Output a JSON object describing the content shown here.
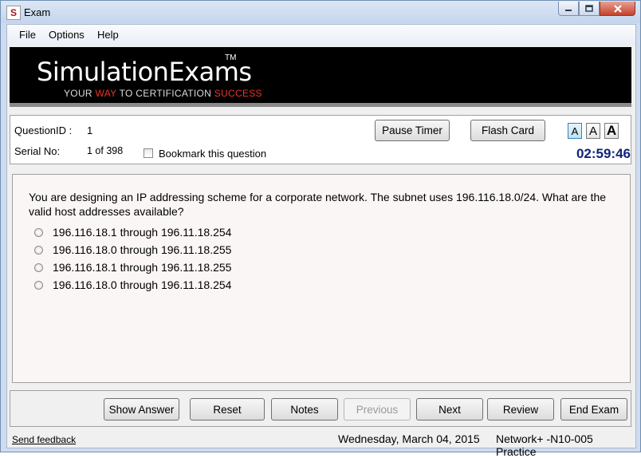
{
  "window": {
    "title": "Exam",
    "app_icon_letter": "S"
  },
  "menu": {
    "file": "File",
    "options": "Options",
    "help": "Help"
  },
  "banner": {
    "brand": "SimulationExams",
    "tm": "TM",
    "tagline_1": "YOUR ",
    "tagline_2": "WAY",
    "tagline_3": " TO CERTIFICATION ",
    "tagline_4": "SUCCESS"
  },
  "question_info": {
    "question_id_label": "QuestionID :",
    "question_id_value": "1",
    "serial_label": "Serial No:",
    "serial_value": "1 of 398",
    "bookmark_label": "Bookmark this question",
    "pause_timer": "Pause Timer",
    "flash_card": "Flash Card",
    "font_small": "A",
    "font_medium": "A",
    "font_large": "A",
    "timer": "02:59:46"
  },
  "question": {
    "text": "You are designing an IP addressing scheme for a corporate network. The subnet uses 196.116.18.0/24. What are the valid host addresses available?",
    "options": [
      "196.116.18.1 through 196.11.18.254",
      "196.116.18.0 through 196.11.18.255",
      "196.116.18.1 through 196.11.18.255",
      "196.116.18.0 through 196.11.18.254"
    ]
  },
  "nav": {
    "show_answer": "Show Answer",
    "reset": "Reset",
    "notes": "Notes",
    "previous": "Previous",
    "next": "Next",
    "review": "Review",
    "end_exam": "End Exam"
  },
  "status": {
    "feedback": "Send feedback",
    "date": "Wednesday, March 04, 2015",
    "exam_name": "Network+ -N10-005 Practice"
  }
}
